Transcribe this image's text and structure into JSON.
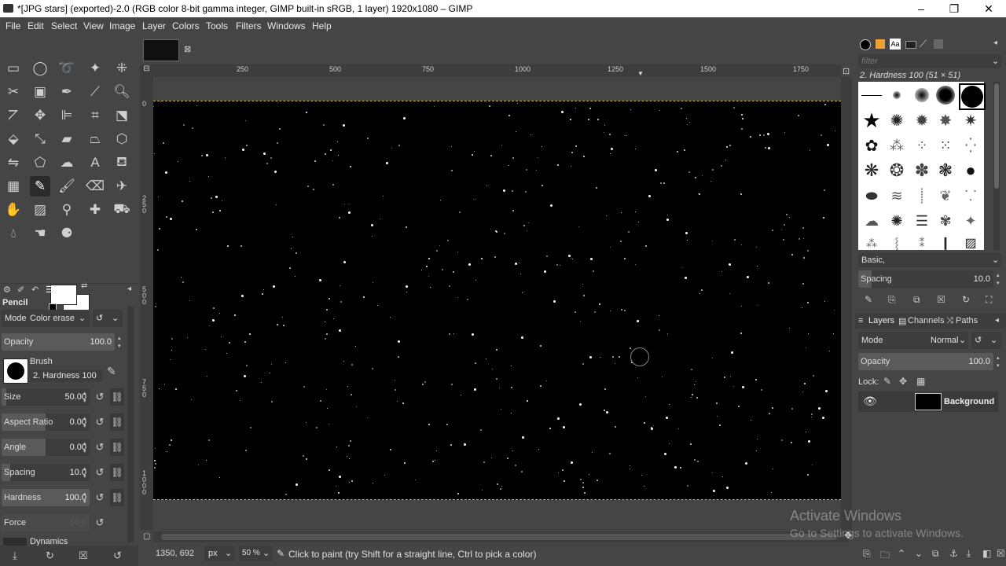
{
  "window": {
    "title": "*[JPG stars] (exported)-2.0 (RGB color 8-bit gamma integer, GIMP built-in sRGB, 1 layer) 1920x1080 – GIMP",
    "minimize": "–",
    "restore": "❐",
    "close": "✕"
  },
  "menu": [
    "File",
    "Edit",
    "Select",
    "View",
    "Image",
    "Layer",
    "Colors",
    "Tools",
    "Filters",
    "Windows",
    "Help"
  ],
  "tool_options": {
    "tool_name": "Pencil",
    "mode_label": "Mode",
    "mode_value": "Color erase",
    "opacity_label": "Opacity",
    "opacity_value": "100.0",
    "opacity_level": 1.0,
    "brush_label": "Brush",
    "brush_value": "2. Hardness 100",
    "size_label": "Size",
    "size_value": "50.00",
    "size_level": 0.05,
    "aspect_label": "Aspect Ratio",
    "aspect_value": "0.00",
    "aspect_level": 0.5,
    "angle_label": "Angle",
    "angle_value": "0.00",
    "angle_level": 0.5,
    "spacing_label": "Spacing",
    "spacing_value": "10.0",
    "spacing_level": 0.1,
    "hardness_label": "Hardness",
    "hardness_value": "100.0",
    "hardness_level": 1.0,
    "force_label": "Force",
    "force_value": "50.0",
    "dynamics_label": "Dynamics"
  },
  "rulers": {
    "top_ticks": [
      "250",
      "500",
      "750",
      "1000",
      "1250",
      "1500",
      "1750"
    ],
    "left_ticks": [
      "0",
      "250",
      "500",
      "750",
      "1000"
    ]
  },
  "status": {
    "coords": "1350, 692",
    "unit": "px",
    "zoom": "50 %",
    "hint": "Click to paint (try Shift for a straight line, Ctrl to pick a color)"
  },
  "brushes": {
    "filter_placeholder": "filter",
    "selected": "2. Hardness 100 (51 × 51)",
    "preset": "Basic,",
    "spacing_label": "Spacing",
    "spacing_value": "10.0"
  },
  "layers": {
    "tabs": [
      "Layers",
      "Channels",
      "Paths"
    ],
    "mode_label": "Mode",
    "mode_value": "Normal",
    "opacity_label": "Opacity",
    "opacity_value": "100.0",
    "lock_label": "Lock:",
    "layer_name": "Background"
  },
  "watermark": {
    "line1": "Activate Windows",
    "line2": "Go to Settings to activate Windows."
  },
  "colors": {
    "fg": "#ffffff",
    "bg": "#ffffff",
    "selection": "#c9b23a"
  }
}
